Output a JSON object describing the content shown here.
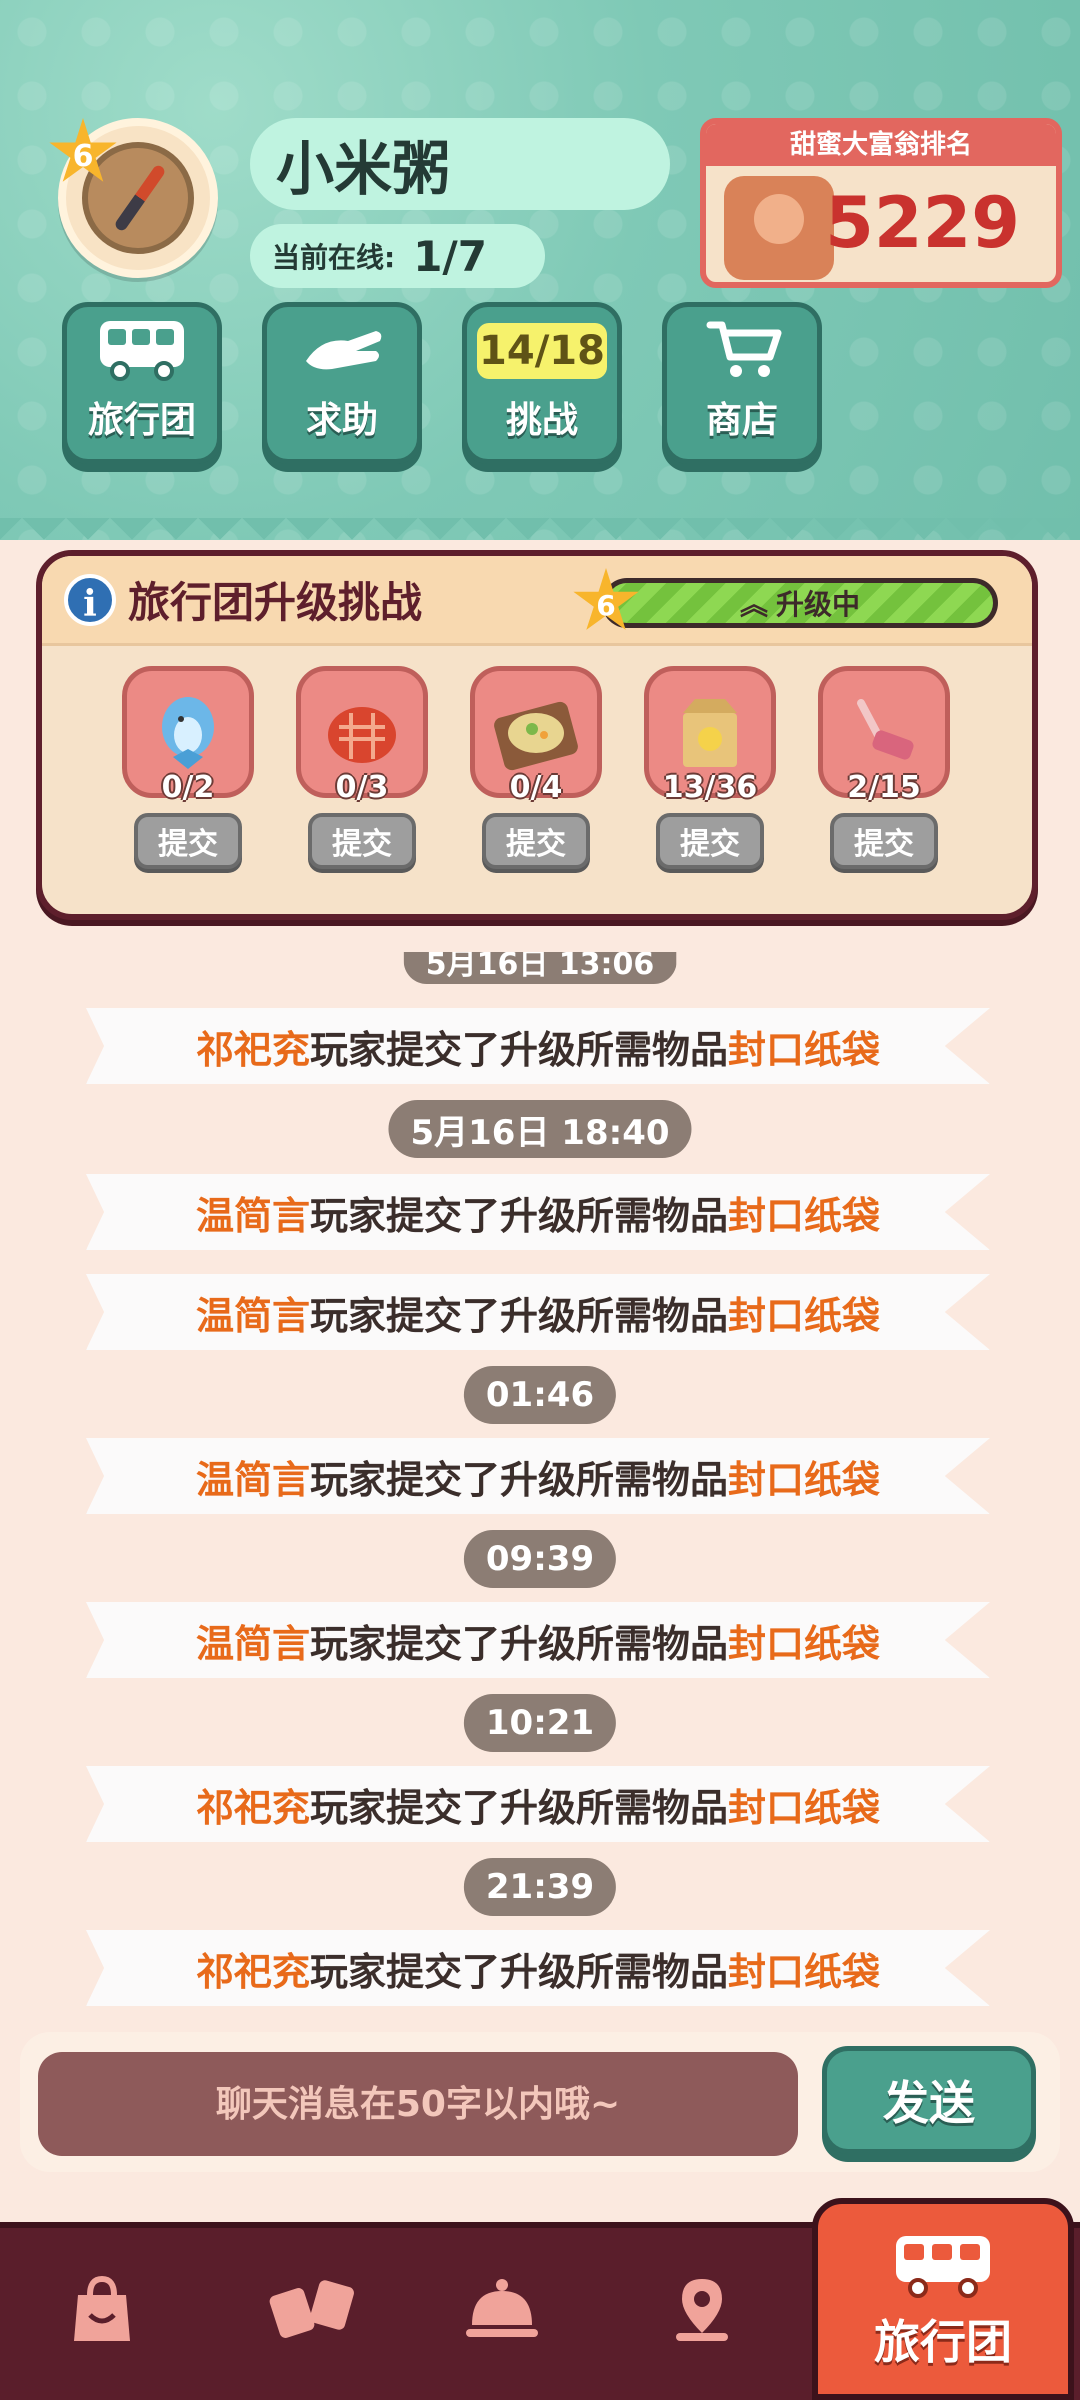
{
  "header": {
    "level": "6",
    "username": "小米粥",
    "online_label": "当前在线:",
    "online_value": "1/7",
    "rank_title": "甜蜜大富翁排名",
    "rank_value": "5229"
  },
  "quick_buttons": [
    {
      "label": "旅行团",
      "icon": "bus-icon"
    },
    {
      "label": "求助",
      "icon": "hand-icon"
    },
    {
      "label": "挑战",
      "icon": "challenge-icon",
      "badge": "14/18"
    },
    {
      "label": "商店",
      "icon": "cart-icon"
    }
  ],
  "challenge": {
    "title": "旅行团升级挑战",
    "level": "6",
    "status": "升级中",
    "items": [
      {
        "name": "dolphin-item",
        "count": "0/2",
        "button": "提交"
      },
      {
        "name": "bread-item",
        "count": "0/3",
        "button": "提交"
      },
      {
        "name": "dish-item",
        "count": "0/4",
        "button": "提交"
      },
      {
        "name": "paper-bag-item",
        "count": "13/36",
        "button": "提交"
      },
      {
        "name": "fork-item",
        "count": "2/15",
        "button": "提交"
      }
    ]
  },
  "feed": {
    "entries": [
      {
        "type": "time",
        "text": "5月16日 13:06"
      },
      {
        "type": "message",
        "player": "祁祀兖",
        "action": "玩家提交了升级所需物品",
        "object": "封口纸袋"
      },
      {
        "type": "time",
        "text": "5月16日 18:40"
      },
      {
        "type": "message",
        "player": "温简言",
        "action": "玩家提交了升级所需物品",
        "object": "封口纸袋"
      },
      {
        "type": "message",
        "player": "温简言",
        "action": "玩家提交了升级所需物品",
        "object": "封口纸袋"
      },
      {
        "type": "time",
        "text": "01:46"
      },
      {
        "type": "message",
        "player": "温简言",
        "action": "玩家提交了升级所需物品",
        "object": "封口纸袋"
      },
      {
        "type": "time",
        "text": "09:39"
      },
      {
        "type": "message",
        "player": "温简言",
        "action": "玩家提交了升级所需物品",
        "object": "封口纸袋"
      },
      {
        "type": "time",
        "text": "10:21"
      },
      {
        "type": "message",
        "player": "祁祀兖",
        "action": "玩家提交了升级所需物品",
        "object": "封口纸袋"
      },
      {
        "type": "time",
        "text": "21:39"
      },
      {
        "type": "message",
        "player": "祁祀兖",
        "action": "玩家提交了升级所需物品",
        "object": "封口纸袋"
      }
    ]
  },
  "chat": {
    "placeholder": "聊天消息在50字以内哦~",
    "send_label": "发送"
  },
  "bottom_nav": {
    "items": [
      {
        "icon": "bag-icon"
      },
      {
        "icon": "cards-icon"
      },
      {
        "icon": "cloche-icon"
      },
      {
        "icon": "map-pin-icon"
      }
    ],
    "active_label": "旅行团",
    "active_icon": "bus-icon"
  },
  "colors": {
    "header_teal": "#71bfac",
    "button_green": "#4aa08d",
    "accent_orange": "#e86a1a",
    "nav_maroon": "#5a1e2b",
    "nav_active": "#ec5a3c"
  }
}
